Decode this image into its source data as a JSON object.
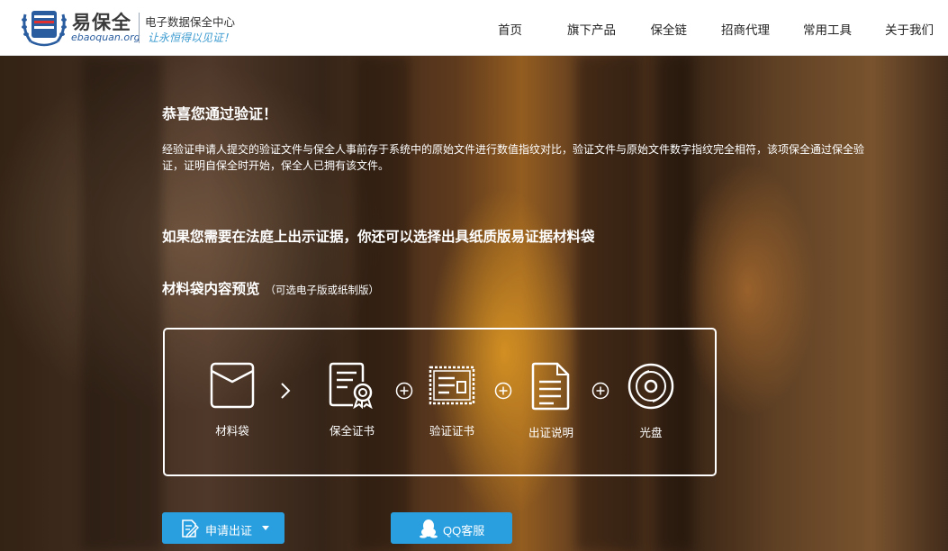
{
  "header": {
    "brand": "易保全",
    "domain": "ebaoquan.org",
    "center": "电子数据保全中心",
    "slogan": "让永恒得以见证！",
    "nav": [
      "首页",
      "旗下产品",
      "保全链",
      "招商代理",
      "常用工具",
      "关于我们"
    ]
  },
  "main": {
    "title": "恭喜您通过验证！",
    "description": "经验证申请人提交的验证文件与保全人事前存于系统中的原始文件进行数值指纹对比，验证文件与原始文件数字指纹完全相符，该项保全通过保全验证，证明自保全时开始，保全人已拥有该文件。",
    "subtitle": "如果您需要在法庭上出示证据，你还可以选择出具纸质版易证据材料袋",
    "preview_title": "材料袋内容预览",
    "preview_note": "（可选电子版或纸制版）",
    "items": [
      {
        "label": "材料袋",
        "icon": "envelope-icon"
      },
      {
        "label": "保全证书",
        "icon": "certificate-icon"
      },
      {
        "label": "验证证书",
        "icon": "stamped-document-icon"
      },
      {
        "label": "出证说明",
        "icon": "document-icon"
      },
      {
        "label": "光盘",
        "icon": "disc-icon"
      }
    ]
  },
  "actions": {
    "apply_label": "申请出证",
    "qq_label": "QQ客服"
  },
  "colors": {
    "accent": "#2a9fe0",
    "text_on_image": "#ffffff",
    "brand_blue": "#2a5d9f"
  }
}
